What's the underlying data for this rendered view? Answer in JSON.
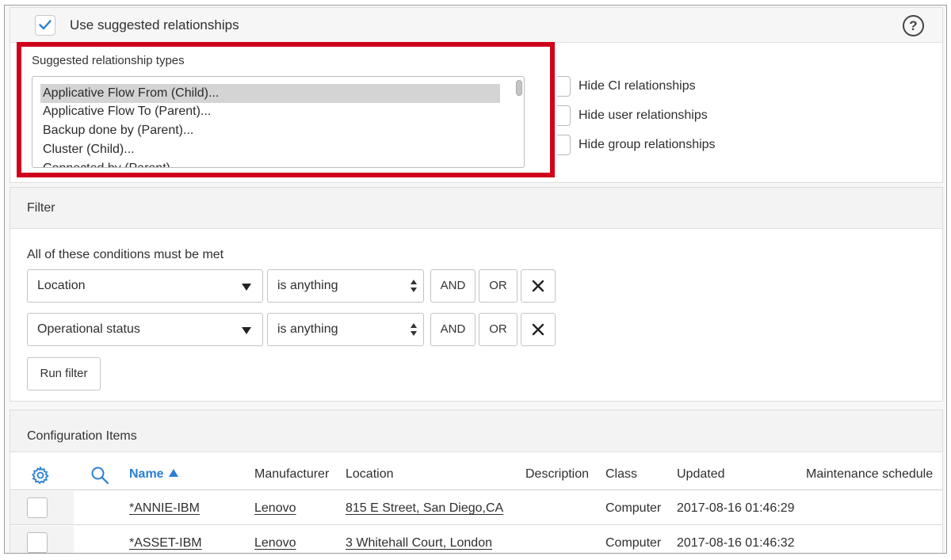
{
  "top": {
    "use_suggested_label": "Use suggested relationships",
    "use_suggested_checked": true,
    "help_glyph": "?",
    "suggested_types_label": "Suggested relationship types",
    "suggested_types": [
      "Applicative Flow From (Child)...",
      "Applicative Flow To (Parent)...",
      "Backup done by (Parent)...",
      "Cluster (Child)...",
      "Connected by (Parent)..."
    ],
    "selected_index": 0,
    "hide_options": [
      "Hide CI relationships",
      "Hide user relationships",
      "Hide group relationships"
    ],
    "highlight_color": "#d0021b"
  },
  "filter": {
    "title": "Filter",
    "conditions_label": "All of these conditions must be met",
    "conditions": [
      {
        "field": "Location",
        "operator": "is anything",
        "and_label": "AND",
        "or_label": "OR"
      },
      {
        "field": "Operational status",
        "operator": "is anything",
        "and_label": "AND",
        "or_label": "OR"
      }
    ],
    "run_label": "Run filter"
  },
  "ci": {
    "title": "Configuration Items",
    "accent_color": "#2a7fd4",
    "columns": [
      "Name",
      "Manufacturer",
      "Location",
      "Description",
      "Class",
      "Updated",
      "Maintenance schedule"
    ],
    "rows": [
      {
        "name": "*ANNIE-IBM",
        "manufacturer": "Lenovo",
        "location": "815 E Street, San Diego,CA",
        "description": "",
        "class": "Computer",
        "updated": "2017-08-16 01:46:29",
        "maintenance": ""
      },
      {
        "name": "*ASSET-IBM",
        "manufacturer": "Lenovo",
        "location": "3 Whitehall Court, London",
        "description": "",
        "class": "Computer",
        "updated": "2017-08-16 01:46:32",
        "maintenance": ""
      }
    ]
  }
}
